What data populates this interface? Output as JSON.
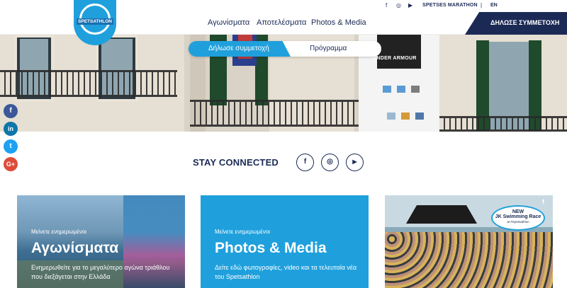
{
  "topbar": {
    "marathon_label": "SPETSES MARATHON",
    "separator": "|",
    "lang_label": "EN"
  },
  "logo": {
    "text": "SPETSATHLON"
  },
  "nav": {
    "items": [
      {
        "label": "Αγωνίσματα"
      },
      {
        "label": "Αποτελέσματα"
      },
      {
        "label": "Photos & Media"
      }
    ],
    "cta_label": "ΔΗΛΩΣΕ ΣΥΜΜΕΤΟΧΗ"
  },
  "hero": {
    "banner_brand": "UNDER ARMOUR",
    "tabs": {
      "active_label": "Δήλωσε συμμετοχή",
      "second_label": "Πρόγραμμα"
    }
  },
  "side_social": {
    "facebook_glyph": "f",
    "linkedin_glyph": "in",
    "twitter_glyph": "t",
    "googleplus_glyph": "G+"
  },
  "stay_connected": {
    "title": "STAY CONNECTED",
    "facebook_glyph": "f",
    "instagram_glyph": "◎",
    "youtube_glyph": "▶"
  },
  "cards": [
    {
      "kicker": "Μείνετε ενημερωμένοι",
      "heading": "Αγωνίσματα",
      "description": "Ενημερωθείτε για το μεγαλύτερο αγώνα τριάθλου που διεξάγεται στην Ελλάδα"
    },
    {
      "kicker": "Μείνετε ενημερωμένοι",
      "heading": "Photos & Media",
      "description": "Δείτε εδώ φωτογραφίες, video και τα τελευταία νέα του Spetsathlon"
    },
    {
      "badge_new": "NEW",
      "badge_title": "JK Swimming Race",
      "badge_sub": "at #Spetsathlon",
      "social_glyph": "f"
    }
  ],
  "colors": {
    "navy": "#1b2a55",
    "brand_blue": "#1fa0dc",
    "facebook": "#3b5998",
    "linkedin": "#0e76a8",
    "twitter": "#1da1f2",
    "googleplus": "#dd4b39"
  }
}
